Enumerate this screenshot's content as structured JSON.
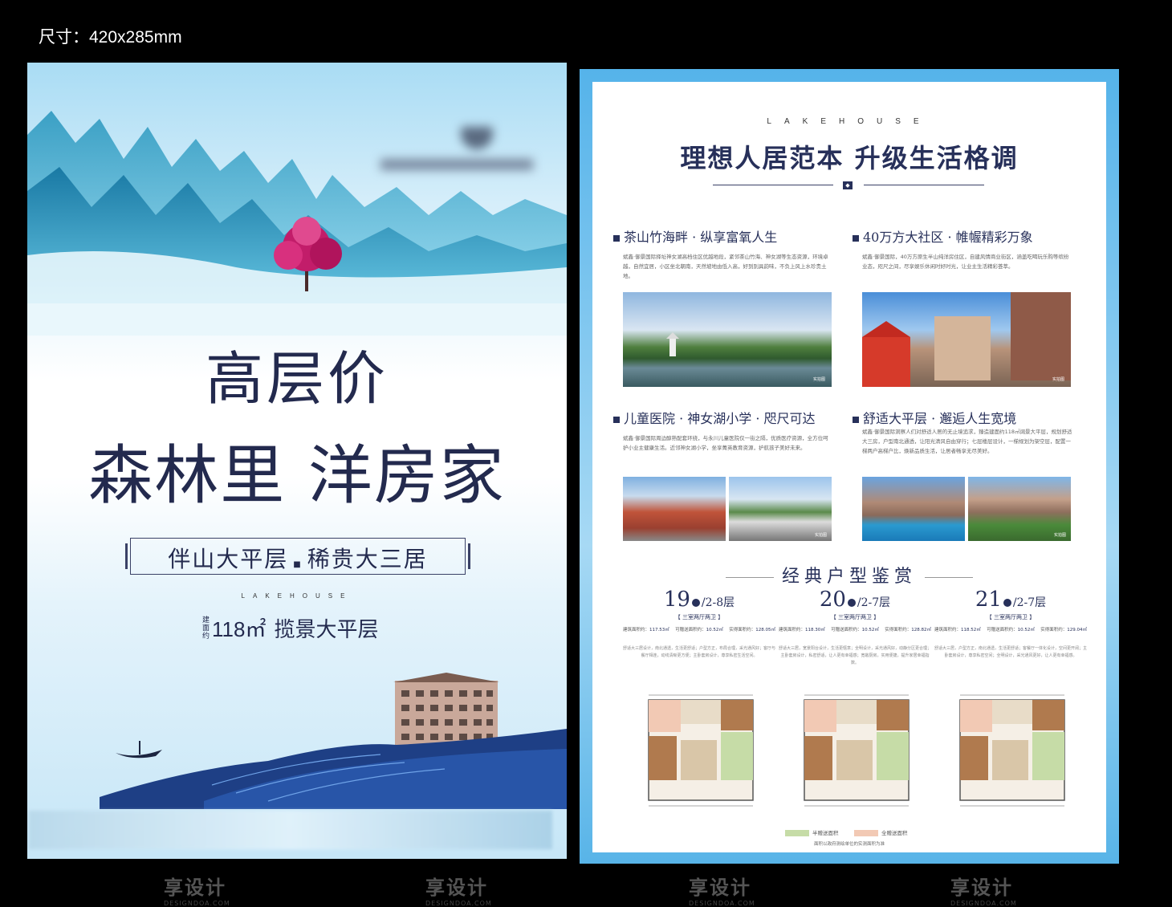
{
  "size_label": "尺寸：420x285mm",
  "watermark": {
    "text": "享设计",
    "sub": "DESIGNDOA.COM"
  },
  "front": {
    "headline_1": "高层价",
    "headline_2": "森林里 洋房家",
    "slogan_left": "伴山大平层",
    "slogan_right": "稀贵大三居",
    "brand_en": "LAKEHOUSE",
    "area_prefix": "建面约",
    "area_value": "118㎡",
    "area_text": "揽景大平层"
  },
  "back": {
    "brand_en": "LAKEHOUSE",
    "title": "理想人居范本 升级生活格调",
    "sections": [
      {
        "title": "茶山竹海畔 · 纵享富氧人生",
        "body": "斌鑫·御景国际择址神女湖高档住区优越地段，紧邻茶山竹海、神女湖等生态资源，环境卓越，自然宜居，小区坐北朝南，天然坡地由低入高，好到别具韵味，不负上风上水珍贵土地。",
        "photo_tag": "实拍图"
      },
      {
        "title": "40万方大社区 · 帷幄精彩万象",
        "body": "斌鑫·御景国际，40万方原生半山纯洋房住区，自建风情商业街区，涵盖吃喝玩乐购等缤纷业态，咫尺之间，尽享娱乐休闲时好时光，让业主生活精彩荟萃。",
        "photo_tag": "实拍图"
      },
      {
        "title": "儿童医院 · 神女湖小学 · 咫尺可达",
        "body": "斌鑫·御景国际周边醇熟配套环绕，与永川儿童医院仅一街之隔，优质医疗资源，全方位呵护小业主健康生活。近邻神女湖小学，坐享菁英教育资源，护航孩子美好未来。",
        "photo_tag": "实拍图"
      },
      {
        "title": "舒适大平层 · 邂逅人生宽境",
        "body": "斌鑫·御景国际洞察人们对舒适人居的无止境追求，臻造建面约118㎡阔景大平层，规划舒适大三房，户型南北通透，让阳光清风自由穿行；七层楼层设计，一梯规划为架空层，配置一梯两户高梯户比，焕新品质生活，让居者畅享无尽美好。",
        "photo_tag": "实拍图"
      }
    ],
    "plans_title": "经典户型鉴赏",
    "plans": [
      {
        "num": "19",
        "floors": "/2-8层",
        "type": "【 三室两厅两卫 】",
        "a1_label": "建筑面积约：",
        "a1": "117.53㎡",
        "a2_label": "可赠送面积约：",
        "a2": "10.52㎡",
        "a3_label": "实得面积约：",
        "a3": "128.05㎡",
        "desc": "舒适大三居设计，南北通透，生活更舒适；户型方正，布局合理，采光通风好；客厅与餐厅相连，动线清晰更方便；主卧套房设计，尊享私密生活空间。"
      },
      {
        "num": "20",
        "floors": "/2-7层",
        "type": "【 三室两厅两卫 】",
        "a1_label": "建筑面积约：",
        "a1": "118.30㎡",
        "a2_label": "可赠送面积约：",
        "a2": "10.52㎡",
        "a3_label": "实得面积约：",
        "a3": "128.82㎡",
        "desc": "舒适大三居，宽景阳台设计，生活更惬意；全明设计，采光通风好，动静分区更合理；主卧套房设计，私密舒适，让人更有幸福感；宽敞厨房，实用便捷，提升家居幸福指数。"
      },
      {
        "num": "21",
        "floors": "/2-7层",
        "type": "【 三室两厅两卫 】",
        "a1_label": "建筑面积约：",
        "a1": "118.52㎡",
        "a2_label": "可赠送面积约：",
        "a2": "10.52㎡",
        "a3_label": "实得面积约：",
        "a3": "129.04㎡",
        "desc": "舒适大三居，户型方正，南北通透，生活更舒适；客餐厅一体化设计，空间更开阔；主卧套房设计，尊享私密空间；全明设计，采光通风更好，让人更有幸福感。"
      }
    ],
    "legend_1": "半赠送面积",
    "legend_2": "全赠送面积",
    "note": "面积以政府测绘单位的实测面积为准",
    "colors": {
      "navy": "#27305a",
      "frame_blue": "#55b3ea",
      "legend_1": "#c6dca7",
      "legend_2": "#f2c9b4"
    }
  }
}
